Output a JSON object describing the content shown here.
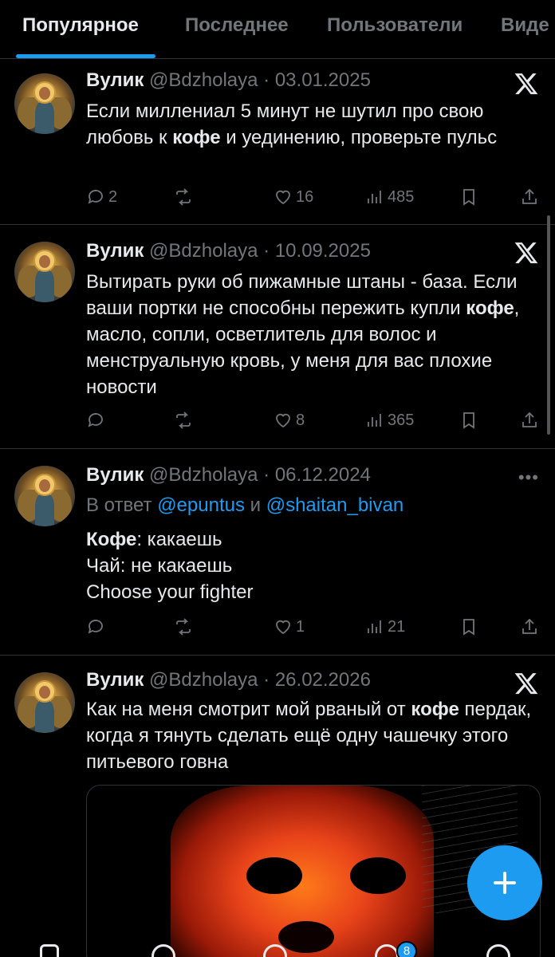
{
  "tabs": [
    {
      "label": "Популярное",
      "active": true
    },
    {
      "label": "Последнее",
      "active": false
    },
    {
      "label": "Пользователи",
      "active": false
    },
    {
      "label": "Виде",
      "active": false
    }
  ],
  "accent_color": "#1d9bf0",
  "tweets": [
    {
      "name": "Вулик",
      "handle": "@Bdzholaya",
      "date": "03.01.2025",
      "corner_icon": "x-logo-icon",
      "text_parts": [
        "Если миллениал 5 минут не шутил про свою любовь к ",
        "кофе",
        " и уединению, проверьте пульс"
      ],
      "replies": "2",
      "retweets": "",
      "likes": "16",
      "views": "485"
    },
    {
      "name": "Вулик",
      "handle": "@Bdzholaya",
      "date": "10.09.2025",
      "corner_icon": "x-logo-icon",
      "text_parts": [
        "Вытирать руки об пижамные штаны - база. Если ваши портки не способны пережить купли ",
        "кофе",
        ", масло, сопли, осветлитель для волос и менструальную кровь, у меня для вас плохие новости"
      ],
      "replies": "",
      "retweets": "",
      "likes": "8",
      "views": "365"
    },
    {
      "name": "Вулик",
      "handle": "@Bdzholaya",
      "date": "06.12.2024",
      "corner_icon": "more-icon",
      "reply_prefix": "В ответ",
      "reply_user1": "@epuntus",
      "reply_and": "и",
      "reply_user2": "@shaitan_bivan",
      "line1_bold": "Кофе",
      "line1_rest": ": какаешь",
      "line2": "Чай: не какаешь",
      "line3": "Choose your fighter",
      "replies": "",
      "retweets": "",
      "likes": "1",
      "views": "21"
    },
    {
      "name": "Вулик",
      "handle": "@Bdzholaya",
      "date": "26.02.2026",
      "corner_icon": "x-logo-icon",
      "text_parts": [
        "Как на меня смотрит мой рваный от ",
        "кофе",
        " пердак, когда я тянуть сделать ещё одну чашечку этого питьевого говна"
      ]
    }
  ],
  "fab_icon": "plus-icon",
  "nav_badge": "8"
}
